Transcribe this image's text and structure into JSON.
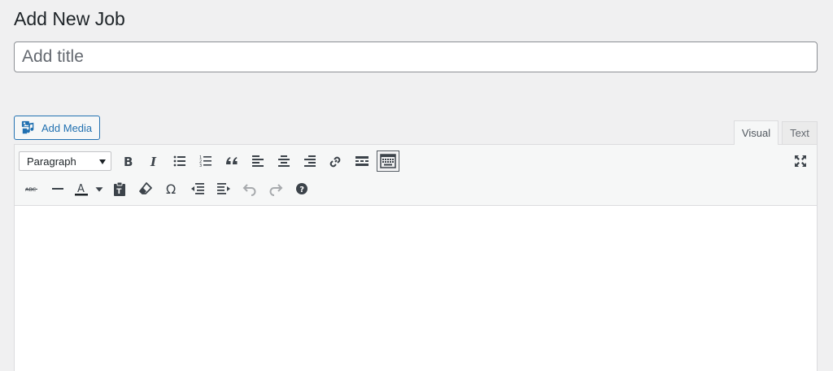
{
  "header": {
    "title": "Add New Job"
  },
  "title_field": {
    "placeholder": "Add title",
    "value": ""
  },
  "media": {
    "add_media_label": "Add Media"
  },
  "tabs": [
    {
      "label": "Visual",
      "active": true
    },
    {
      "label": "Text",
      "active": false
    }
  ],
  "toolbar": {
    "format_select": {
      "selected": "Paragraph"
    },
    "row1_icons": [
      "bold-icon",
      "italic-icon",
      "bulleted-list-icon",
      "numbered-list-icon",
      "blockquote-icon",
      "align-left-icon",
      "align-center-icon",
      "align-right-icon",
      "link-icon",
      "read-more-icon",
      "toolbar-toggle-icon"
    ],
    "row2_icons": [
      "strikethrough-icon",
      "horizontal-line-icon",
      "text-color-icon",
      "paste-as-text-icon",
      "clear-formatting-icon",
      "special-character-icon",
      "outdent-icon",
      "indent-icon",
      "undo-icon",
      "redo-icon",
      "help-icon"
    ]
  },
  "colors": {
    "accent": "#2271b1",
    "background": "#f0f0f1",
    "toolbar": "#f6f7f7"
  }
}
